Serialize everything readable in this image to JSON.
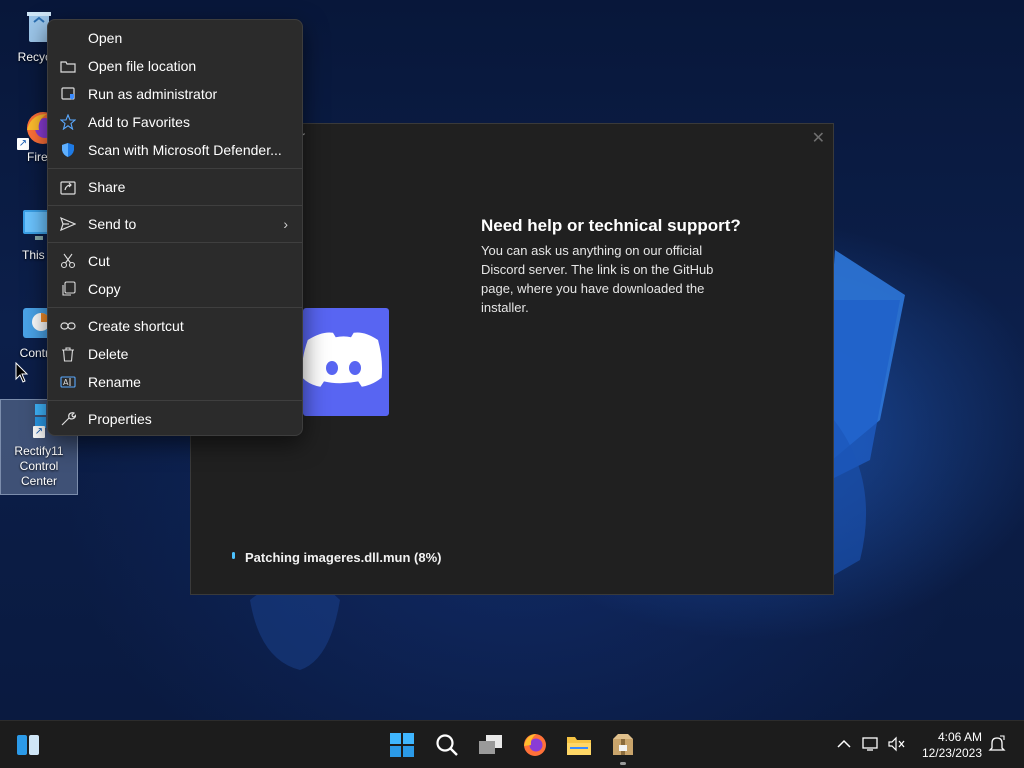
{
  "desktop": {
    "icons": [
      {
        "label": "Recycle Bin",
        "visible_label": "Recycle"
      },
      {
        "label": "Firefox",
        "visible_label": "Firef"
      },
      {
        "label": "This PC",
        "visible_label": "This P"
      },
      {
        "label": "Control Panel",
        "visible_label": "Control"
      },
      {
        "label": "Rectify11 Control Center",
        "visible_label": "Rectify11 Control Center"
      }
    ]
  },
  "installer": {
    "title_fragment": "r",
    "close_glyph": "✕",
    "help_title": "Need help or technical support?",
    "help_body": "You can ask us anything on our official Discord server. The link is on the GitHub page, where you have downloaded the installer.",
    "status": "Patching imageres.dll.mun (8%)",
    "discord_color": "#5865f2"
  },
  "context_menu": {
    "items": [
      {
        "label": "Open",
        "icon": "none"
      },
      {
        "label": "Open file location",
        "icon": "folder-icon"
      },
      {
        "label": "Run as administrator",
        "icon": "admin-shield-icon"
      },
      {
        "label": "Add to Favorites",
        "icon": "star-icon"
      },
      {
        "label": "Scan with Microsoft Defender...",
        "icon": "defender-icon"
      },
      {
        "label": "Share",
        "icon": "share-icon"
      },
      {
        "label": "Send to",
        "icon": "send-icon",
        "chevron": "›"
      },
      {
        "label": "Cut",
        "icon": "scissors-icon"
      },
      {
        "label": "Copy",
        "icon": "copy-icon"
      },
      {
        "label": "Create shortcut",
        "icon": "link-icon"
      },
      {
        "label": "Delete",
        "icon": "trash-icon"
      },
      {
        "label": "Rename",
        "icon": "rename-icon"
      },
      {
        "label": "Properties",
        "icon": "wrench-icon"
      }
    ]
  },
  "taskbar": {
    "clock_time": "4:06 AM",
    "clock_date": "12/23/2023",
    "accent": "#0078d4"
  }
}
